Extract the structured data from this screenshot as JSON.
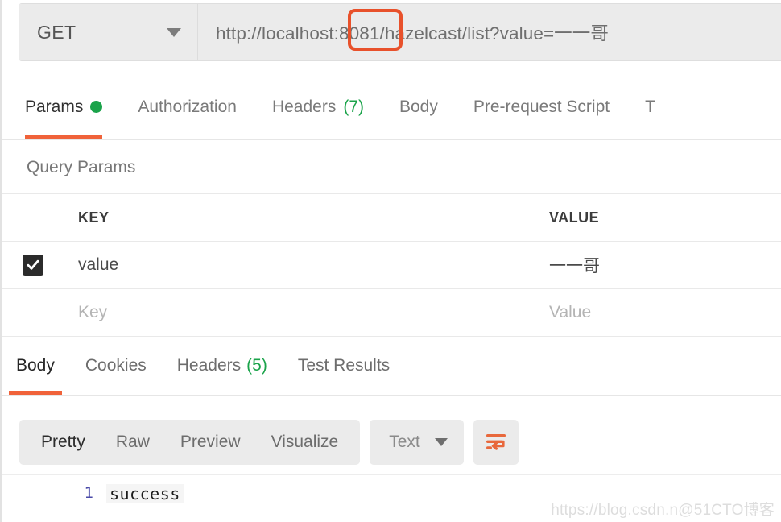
{
  "request_bar": {
    "method": "GET",
    "method_caret_icon": "chevron-down-icon",
    "url": "http://localhost:8081/hazelcast/list?value=一一哥",
    "highlight_note": ":8081/"
  },
  "request_tabs": [
    {
      "label": "Params",
      "active": true,
      "indicator": "green-dot",
      "count": ""
    },
    {
      "label": "Authorization",
      "active": false,
      "indicator": "",
      "count": ""
    },
    {
      "label": "Headers",
      "active": false,
      "indicator": "",
      "count": "(7)"
    },
    {
      "label": "Body",
      "active": false,
      "indicator": "",
      "count": ""
    },
    {
      "label": "Pre-request Script",
      "active": false,
      "indicator": "",
      "count": ""
    },
    {
      "label": "T",
      "active": false,
      "indicator": "",
      "count": ""
    }
  ],
  "query_params": {
    "heading": "Query Params",
    "columns": {
      "key": "KEY",
      "value": "VALUE"
    },
    "rows": [
      {
        "checked": true,
        "key": "value",
        "value": "一一哥",
        "placeholder_row": false
      },
      {
        "checked": false,
        "key": "Key",
        "value": "Value",
        "placeholder_row": true
      }
    ]
  },
  "response_tabs": [
    {
      "label": "Body",
      "active": true,
      "count": ""
    },
    {
      "label": "Cookies",
      "active": false,
      "count": ""
    },
    {
      "label": "Headers",
      "active": false,
      "count": "(5)"
    },
    {
      "label": "Test Results",
      "active": false,
      "count": ""
    }
  ],
  "view_toolbar": {
    "segments": [
      {
        "label": "Pretty",
        "active": true
      },
      {
        "label": "Raw",
        "active": false
      },
      {
        "label": "Preview",
        "active": false
      },
      {
        "label": "Visualize",
        "active": false
      }
    ],
    "format": "Text",
    "format_caret_icon": "chevron-down-icon",
    "wrap_icon": "word-wrap-icon"
  },
  "response_body": {
    "line_number": "1",
    "content": "success"
  },
  "watermark": "https://blog.csdn.n@51CTO博客",
  "colors": {
    "accent_orange": "#f0623a",
    "highlight_red": "#e8512b",
    "indicator_green": "#1aa34a",
    "toolbar_grey": "#ebebeb",
    "text_dark": "#303030",
    "text_muted": "#7a7a7a"
  }
}
